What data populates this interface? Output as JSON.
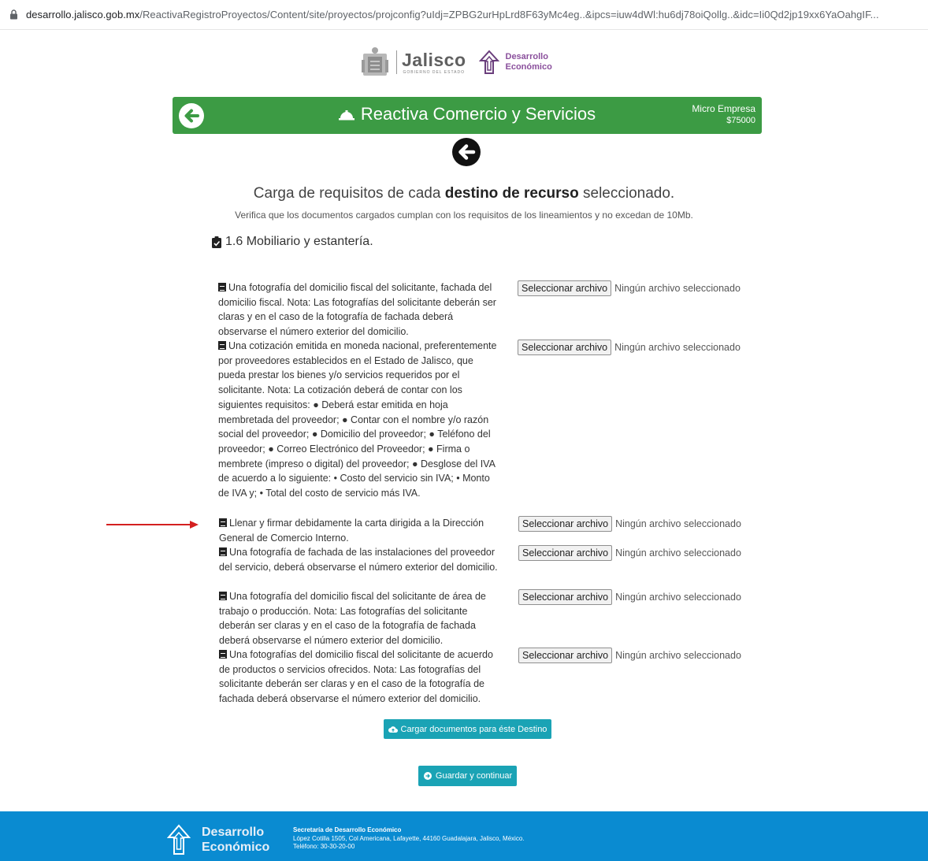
{
  "browser": {
    "url_host": "desarrollo.jalisco.gob.mx",
    "url_path": "/ReactivaRegistroProyectos/Content/site/proyectos/projconfig?uIdj=ZPBG2urHpLrd8F63yMc4eg..&ipcs=iuw4dWl:hu6dj78oiQollg..&idc=Ii0Qd2jp19xx6YaOahgIF..."
  },
  "logos": {
    "jalisco": "Jalisco",
    "jalisco_sub": "GOBIERNO DEL ESTADO",
    "de_line1": "Desarrollo",
    "de_line2": "Económico"
  },
  "header": {
    "title": "Reactiva Comercio y Servicios",
    "company_type": "Micro Empresa",
    "amount": "$75000"
  },
  "page": {
    "heading_pre": "Carga de requisitos de cada ",
    "heading_bold": "destino de recurso",
    "heading_post": " seleccionado.",
    "subheading": "Verifica que los documentos cargados cumplan con los requisitos de los lineamientos y no excedan de 10Mb.",
    "section_title": "1.6 Mobiliario y estantería."
  },
  "file_input": {
    "button_label": "Seleccionar archivo",
    "status": "Ningún archivo seleccionado"
  },
  "requirements": [
    {
      "text": "Una fotografía del domicilio fiscal del solicitante, fachada del domicilio fiscal. Nota: Las fotografías del solicitante deberán ser claras y en el caso de la fotografía de fachada deberá observarse el número exterior del domicilio."
    },
    {
      "text": "Una cotización emitida en moneda nacional, preferentemente por proveedores establecidos en el Estado de Jalisco, que pueda prestar los bienes y/o servicios requeridos por el solicitante. Nota: La cotización deberá de contar con los siguientes requisitos: ● Deberá estar emitida en hoja membretada del proveedor; ● Contar con el nombre y/o razón social del proveedor; ● Domicilio del proveedor; ● Teléfono del proveedor; ● Correo Electrónico del Proveedor; ● Firma o membrete (impreso o digital) del proveedor; ● Desglose del IVA de acuerdo a lo siguiente: • Costo del servicio sin IVA; • Monto de IVA y; • Total del costo de servicio más IVA."
    },
    {
      "text": "Llenar y firmar debidamente la carta dirigida a la Dirección General de Comercio Interno."
    },
    {
      "text": "Una fotografía de fachada de las instalaciones del proveedor del servicio, deberá observarse el número exterior del domicilio."
    },
    {
      "text": "Una fotografía del domicilio fiscal del solicitante de área de trabajo o producción. Nota: Las fotografías del solicitante deberán ser claras y en el caso de la fotografía de fachada deberá observarse el número exterior del domicilio."
    },
    {
      "text": "Una fotografías del domicilio fiscal del solicitante de acuerdo de productos o servicios ofrecidos. Nota: Las fotografías del solicitante deberán ser claras y en el caso de la fotografía de fachada deberá observarse el número exterior del domicilio."
    }
  ],
  "actions": {
    "upload_label": "Cargar documentos para éste Destino",
    "save_label": "Guardar y continuar"
  },
  "footer": {
    "brand_line1": "Desarrollo",
    "brand_line2": "Económico",
    "org_name": "Secretaría de Desarrollo Económico",
    "address": "López Cotilla 1505, Col Americana, Lafayette, 44160 Guadalajara, Jalisco, México.",
    "phone": "Teléfono: 30-30-20-00"
  },
  "colors": {
    "header_green": "#3c9b44",
    "button_teal": "#1aa3b5",
    "footer_blue": "#0a8bd1",
    "arrow_red": "#d42020"
  }
}
